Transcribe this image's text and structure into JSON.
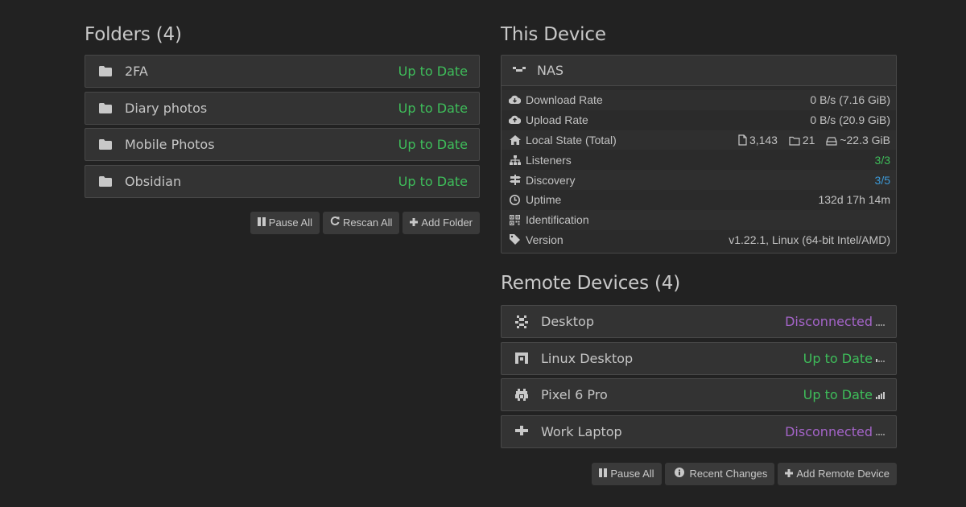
{
  "folders": {
    "heading": "Folders (4)",
    "items": [
      {
        "name": "2FA",
        "status": "Up to Date"
      },
      {
        "name": "Diary photos",
        "status": "Up to Date"
      },
      {
        "name": "Mobile Photos",
        "status": "Up to Date"
      },
      {
        "name": "Obsidian",
        "status": "Up to Date"
      }
    ],
    "buttons": {
      "pause_all": "Pause All",
      "rescan_all": "Rescan All",
      "add_folder": "Add Folder"
    }
  },
  "this_device": {
    "heading": "This Device",
    "name": "NAS",
    "stats": {
      "download_label": "Download Rate",
      "download_value": "0 B/s (7.16 GiB)",
      "upload_label": "Upload Rate",
      "upload_value": "0 B/s (20.9 GiB)",
      "local_state_label": "Local State (Total)",
      "local_files": "3,143",
      "local_dirs": "21",
      "local_size": "~22.3 GiB",
      "listeners_label": "Listeners",
      "listeners_value": "3/3",
      "discovery_label": "Discovery",
      "discovery_value": "3/5",
      "uptime_label": "Uptime",
      "uptime_value": "132d 17h 14m",
      "identification_label": "Identification",
      "identification_value": "",
      "version_label": "Version",
      "version_value": "v1.22.1, Linux (64-bit Intel/AMD)"
    }
  },
  "remote_devices": {
    "heading": "Remote Devices (4)",
    "items": [
      {
        "name": "Desktop",
        "status": "Disconnected"
      },
      {
        "name": "Linux Desktop",
        "status": "Up to Date"
      },
      {
        "name": "Pixel 6 Pro",
        "status": "Up to Date"
      },
      {
        "name": "Work Laptop",
        "status": "Disconnected"
      }
    ],
    "buttons": {
      "pause_all": "Pause All",
      "recent_changes": "Recent Changes",
      "add_remote_device": "Add Remote Device"
    }
  },
  "colors": {
    "background": "#222222",
    "panel": "#333333",
    "up_to_date": "#3ebd5a",
    "disconnected": "#a464c8",
    "discovery": "#3c9ad8"
  }
}
